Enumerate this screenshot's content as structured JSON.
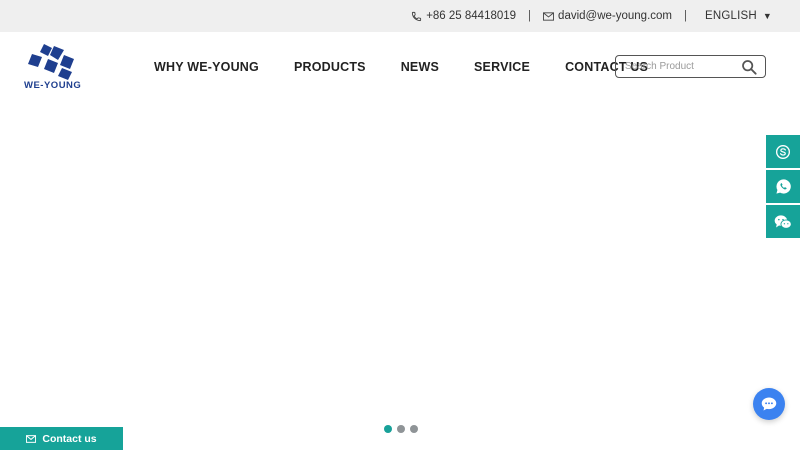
{
  "topbar": {
    "phone": "+86 25 84418019",
    "separator": "|",
    "email": "david@we-young.com",
    "language": "ENGLISH",
    "language_caret": "▼"
  },
  "header": {
    "logo_text": "WE-YOUNG",
    "nav": [
      {
        "label": "WHY WE-YOUNG"
      },
      {
        "label": "PRODUCTS"
      },
      {
        "label": "NEWS"
      },
      {
        "label": "SERVICE"
      },
      {
        "label": "CONTACT US"
      }
    ],
    "search": {
      "placeholder": "Search Product",
      "value": ""
    }
  },
  "social": [
    "skype-icon",
    "whatsapp-icon",
    "wechat-icon"
  ],
  "slider": {
    "dot_count": 3,
    "active_index": 0
  },
  "contact_tab": {
    "label": "Contact us"
  },
  "colors": {
    "accent": "#16a399",
    "logo_blue": "#1f3f8f",
    "chat_blue": "#3b82f0",
    "topbar_bg": "#efefef"
  }
}
